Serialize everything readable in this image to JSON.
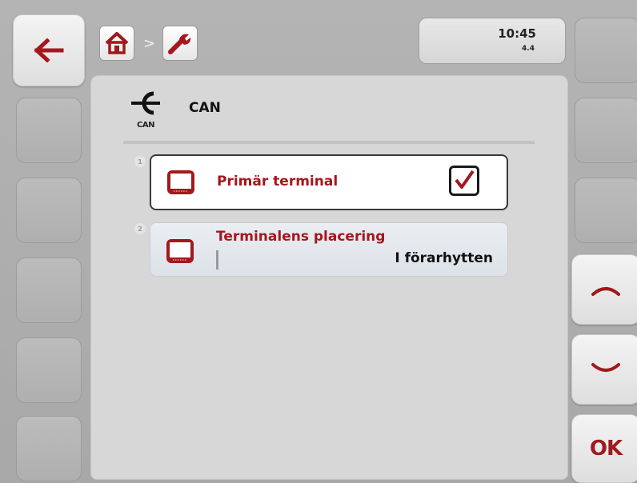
{
  "header": {
    "breadcrumb": [
      {
        "name": "home-icon"
      },
      {
        "name": "wrench-icon"
      }
    ],
    "separator": ">",
    "time": "10:45",
    "version": "4.4"
  },
  "title": {
    "icon": "can-plug-icon",
    "icon_caption": "CAN",
    "text": "CAN"
  },
  "items": [
    {
      "number": "1",
      "icon": "terminal-icon",
      "label": "Primär terminal",
      "checked": true
    },
    {
      "number": "2",
      "icon": "terminal-icon",
      "label": "Terminalens placering",
      "value": "I förarhytten"
    }
  ],
  "softkeys": {
    "back": "back-arrow-icon",
    "up": "chevron-up-icon",
    "down": "chevron-down-icon",
    "ok_label": "OK"
  },
  "colors": {
    "accent": "#a3181d",
    "panel": "#d7d7d7",
    "frame": "#b0b0b0"
  }
}
